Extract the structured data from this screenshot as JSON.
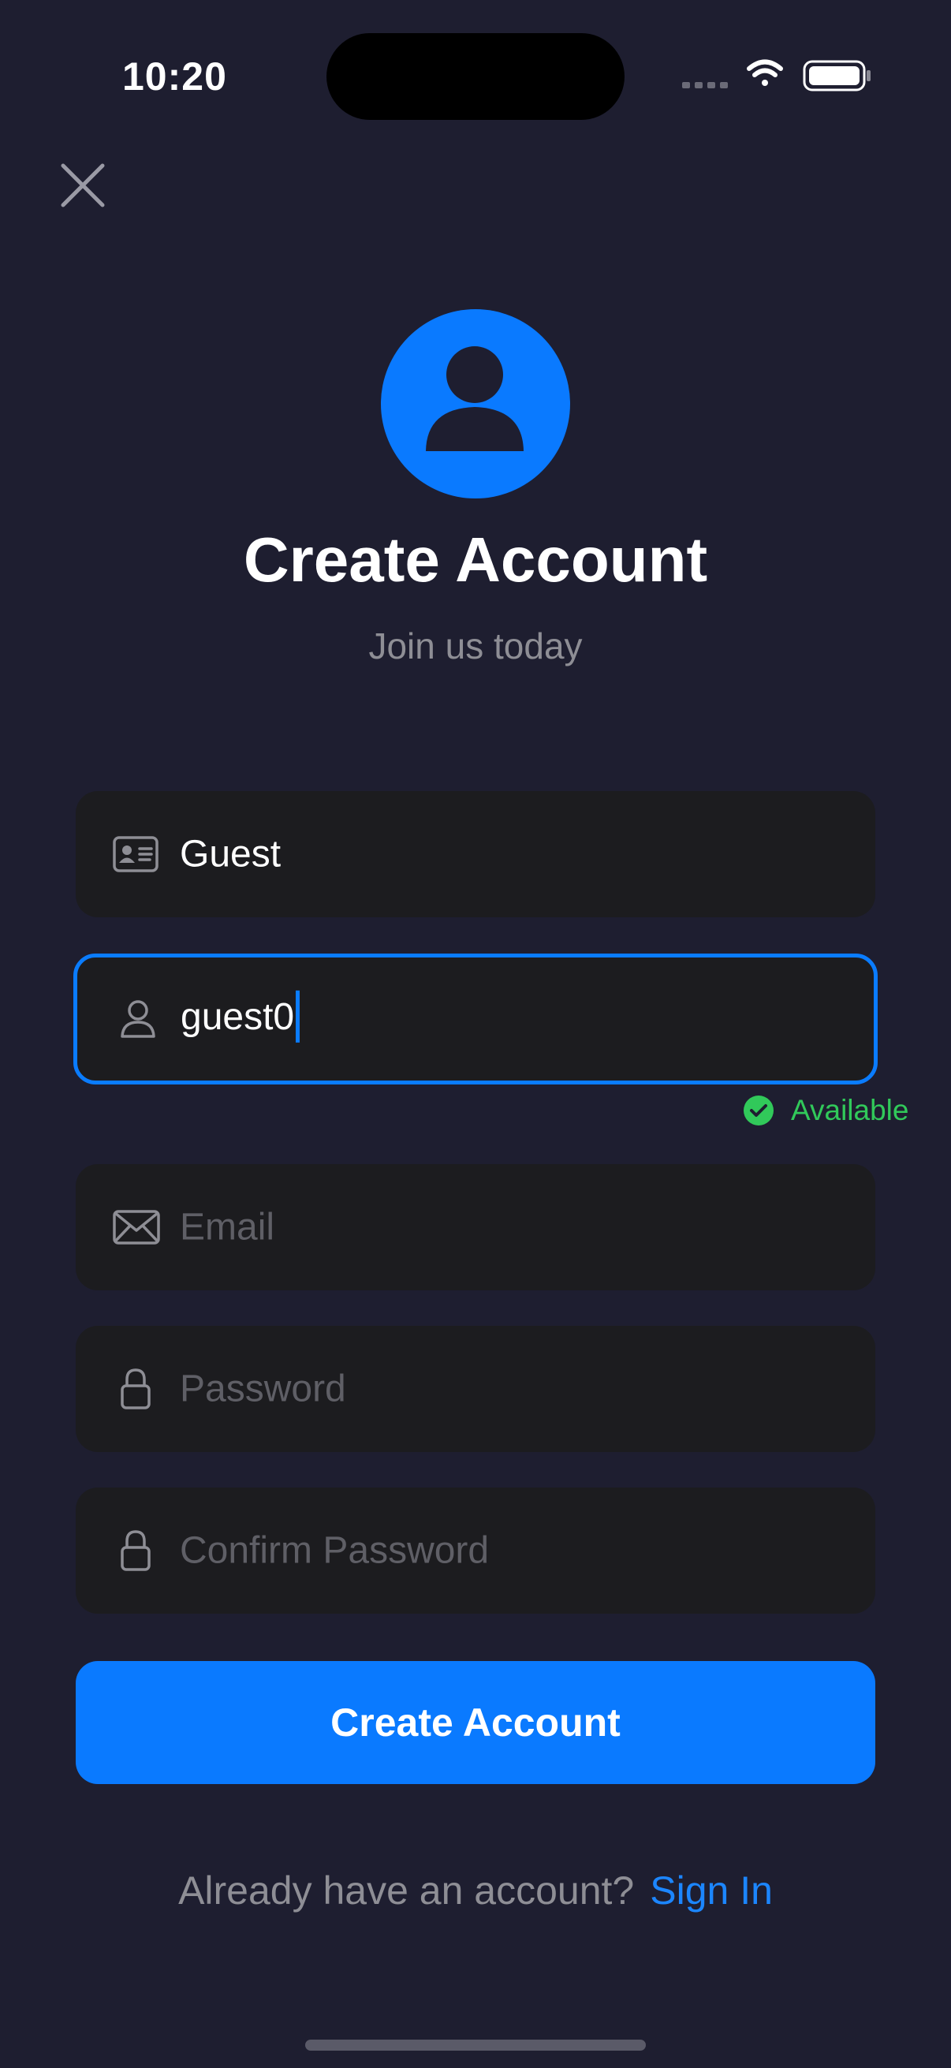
{
  "status_bar": {
    "time": "10:20"
  },
  "header": {
    "title": "Create Account",
    "subtitle": "Join us today"
  },
  "form": {
    "full_name": {
      "value": "Guest",
      "icon": "id-card-icon"
    },
    "username": {
      "value": "guest0",
      "icon": "person-icon",
      "status": "Available"
    },
    "email": {
      "placeholder": "Email",
      "icon": "envelope-icon"
    },
    "password": {
      "placeholder": "Password",
      "icon": "lock-icon"
    },
    "confirm_password": {
      "placeholder": "Confirm Password",
      "icon": "lock-icon"
    }
  },
  "actions": {
    "create_label": "Create Account",
    "signin_prompt": "Already have an account?",
    "signin_link": "Sign In"
  },
  "colors": {
    "background": "#1e1e30",
    "accent": "#0a7aff",
    "field_bg": "#1c1c1f",
    "success": "#31c95a"
  }
}
